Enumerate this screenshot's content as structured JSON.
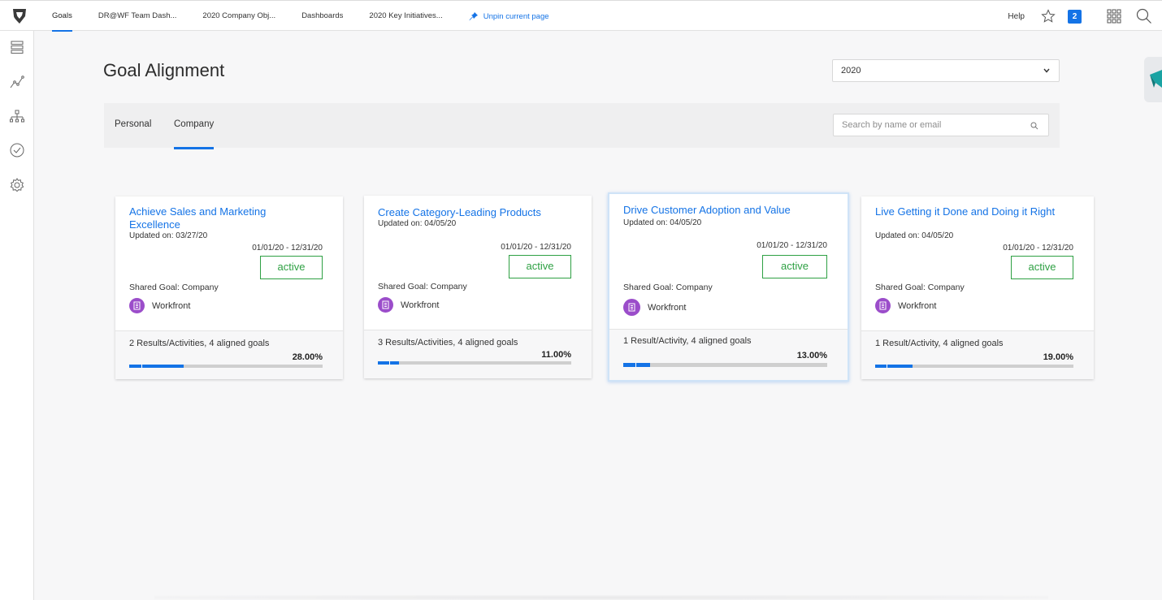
{
  "topbar": {
    "tabs": [
      {
        "label": "Goals"
      },
      {
        "label": "DR@WF Team Dash..."
      },
      {
        "label": "2020 Company Obj..."
      },
      {
        "label": "Dashboards"
      },
      {
        "label": "2020 Key Initiatives..."
      }
    ],
    "unpin_label": "Unpin current page",
    "help_label": "Help",
    "notification_count": "2",
    "accent_color": "#1473e6"
  },
  "rail": {
    "icons": [
      "list-icon",
      "chart-line-icon",
      "hierarchy-icon",
      "check-circle-icon",
      "gear-icon"
    ]
  },
  "main": {
    "title": "Goal Alignment",
    "year_select": {
      "value": "2020"
    },
    "filter_tabs": [
      {
        "label": "Personal"
      },
      {
        "label": "Company"
      }
    ],
    "search": {
      "placeholder": "Search by name or email"
    }
  },
  "goals": [
    {
      "title": "Achieve Sales and Marketing Excellence",
      "updated": "Updated on: 03/27/20",
      "dates": "01/01/20 - 12/31/20",
      "status": "active",
      "shared": "Shared Goal: Company",
      "owner": "Workfront",
      "results": "2 Results/Activities, 4 aligned goals",
      "progress_label": "28.00%",
      "progress": 28
    },
    {
      "title": "Create Category-Leading Products",
      "updated": "Updated on: 04/05/20",
      "dates": "01/01/20 - 12/31/20",
      "status": "active",
      "shared": "Shared Goal: Company",
      "owner": "Workfront",
      "results": "3 Results/Activities, 4 aligned goals",
      "progress_label": "11.00%",
      "progress": 11
    },
    {
      "title": "Drive Customer Adoption and Value",
      "updated": "Updated on: 04/05/20",
      "dates": "01/01/20 - 12/31/20",
      "status": "active",
      "shared": "Shared Goal: Company",
      "owner": "Workfront",
      "results": "1 Result/Activity, 4 aligned goals",
      "progress_label": "13.00%",
      "progress": 13
    },
    {
      "title": "Live Getting it Done and Doing it Right",
      "updated": "Updated on: 04/05/20",
      "dates": "01/01/20 - 12/31/20",
      "status": "active",
      "shared": "Shared Goal: Company",
      "owner": "Workfront",
      "results": "1 Result/Activity, 4 aligned goals",
      "progress_label": "19.00%",
      "progress": 19
    }
  ]
}
